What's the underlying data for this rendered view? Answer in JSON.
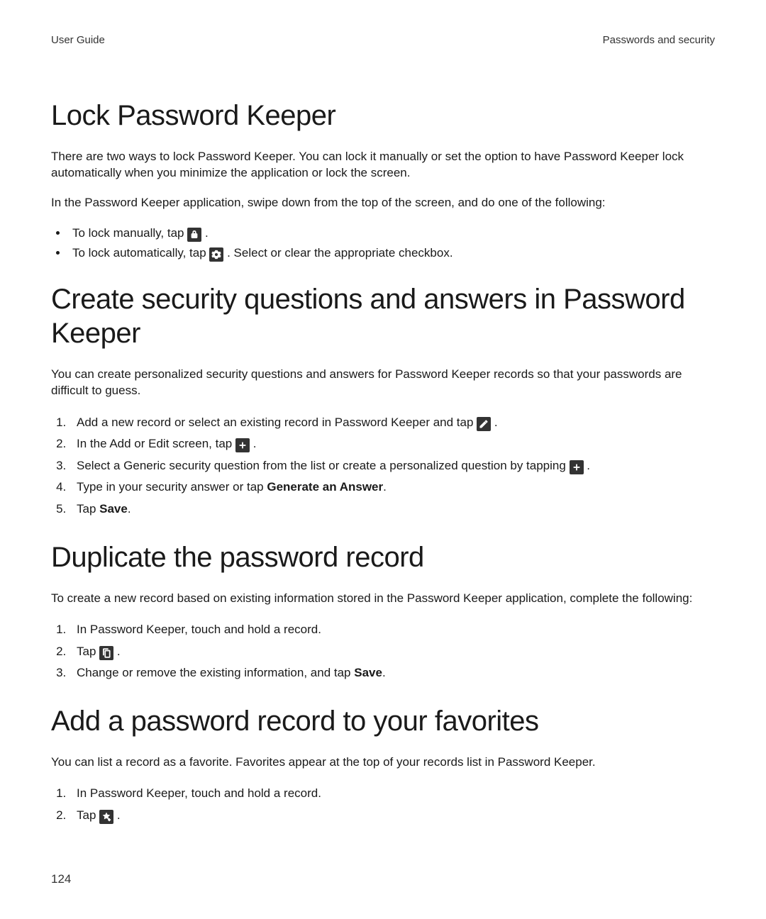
{
  "header": {
    "left": "User Guide",
    "right": "Passwords and security"
  },
  "page_number": "124",
  "bold": {
    "generate_answer": "Generate an Answer",
    "save": "Save"
  },
  "sec1": {
    "title": "Lock Password Keeper",
    "p1": "There are two ways to lock Password Keeper. You can lock it manually or set the option to have Password Keeper lock automatically when you minimize the application or lock the screen.",
    "p2": "In the Password Keeper application, swipe down from the top of the screen, and do one of the following:",
    "b1_a": "To lock manually, tap ",
    "b1_b": " .",
    "b2_a": "To lock automatically, tap ",
    "b2_b": " . Select or clear the appropriate checkbox."
  },
  "sec2": {
    "title": "Create security questions and answers in Password Keeper",
    "p1": "You can create personalized security questions and answers for Password Keeper records so that your passwords are difficult to guess.",
    "s1_a": "Add a new record or select an existing record in Password Keeper and tap ",
    "s1_b": " .",
    "s2_a": "In the Add or Edit screen, tap ",
    "s2_b": " .",
    "s3_a": "Select a Generic security question from the list or create a personalized question by tapping ",
    "s3_b": " .",
    "s4_a": "Type in your security answer or tap ",
    "s4_b": ".",
    "s5_a": "Tap ",
    "s5_b": "."
  },
  "sec3": {
    "title": "Duplicate the password record",
    "p1": "To create a new record based on existing information stored in the Password Keeper application, complete the following:",
    "s1": "In Password Keeper, touch and hold a record.",
    "s2_a": "Tap ",
    "s2_b": " .",
    "s3_a": "Change or remove the existing information, and tap ",
    "s3_b": "."
  },
  "sec4": {
    "title": "Add a password record to your favorites",
    "p1": "You can list a record as a favorite. Favorites appear at the top of your records list in Password Keeper.",
    "s1": "In Password Keeper, touch and hold a record.",
    "s2_a": "Tap ",
    "s2_b": " ."
  }
}
